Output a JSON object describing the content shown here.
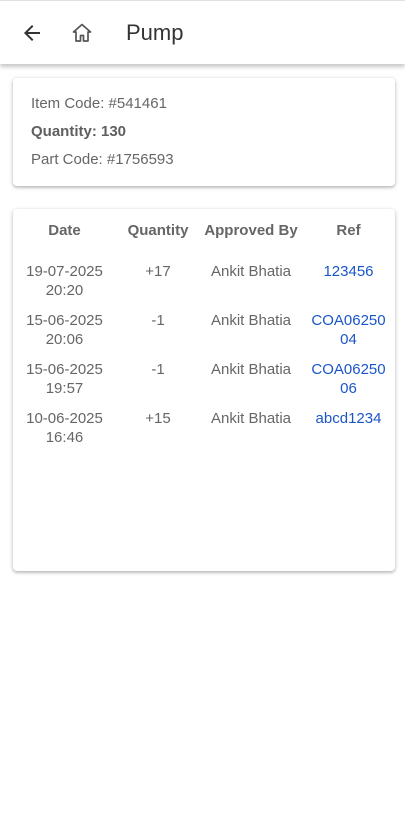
{
  "appbar": {
    "title": "Pump",
    "back_icon": "arrow-left-icon",
    "home_icon": "home-icon"
  },
  "item": {
    "item_code": "Item Code: #541461",
    "quantity": "Quantity: 130",
    "part_code": "Part Code: #1756593"
  },
  "history": {
    "headers": [
      "Date",
      "Quantity",
      "Approved By",
      "Ref"
    ],
    "rows": [
      {
        "date": "19-07-2025 20:20",
        "quantity": "+17",
        "approved_by": "Ankit Bhatia",
        "ref": "123456"
      },
      {
        "date": "15-06-2025 20:06",
        "quantity": "-1",
        "approved_by": "Ankit Bhatia",
        "ref": "COA0625004"
      },
      {
        "date": "15-06-2025 19:57",
        "quantity": "-1",
        "approved_by": "Ankit Bhatia",
        "ref": "COA0625006"
      },
      {
        "date": "10-06-2025 16:46",
        "quantity": "+15",
        "approved_by": "Ankit Bhatia",
        "ref": "abcd1234"
      }
    ]
  },
  "colors": {
    "link": "#1a56c8",
    "text": "#666666",
    "title": "#333333"
  }
}
